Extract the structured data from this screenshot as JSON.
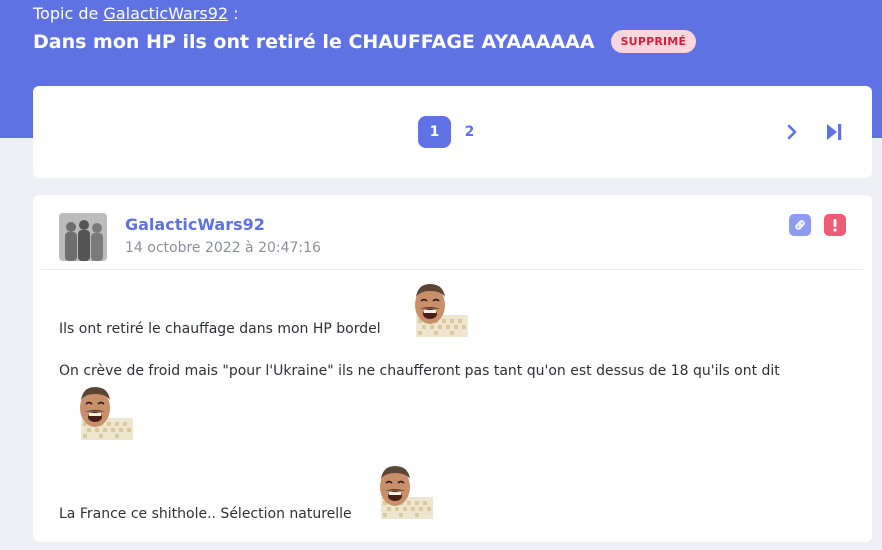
{
  "header": {
    "topic_prefix": "Topic de",
    "topic_author": "GalacticWars92",
    "topic_suffix": " :",
    "title": "Dans mon HP ils ont retiré le CHAUFFAGE AYAAAAAA",
    "status_badge": "SUPPRIMÉ"
  },
  "pagination": {
    "pages": [
      "1",
      "2"
    ],
    "current": "1",
    "next_icon": "chevron-right-icon",
    "last_icon": "skip-to-end-icon"
  },
  "post": {
    "author": "GalacticWars92",
    "date": "14 octobre 2022 à 20:47:16",
    "actions": [
      "link-icon",
      "report-icon"
    ],
    "paragraphs": [
      "Ils ont retiré le chauffage dans mon HP bordel",
      "On crève de froid mais \"pour l'Ukraine\" ils ne chaufferont pas tant qu'on est dessus de 18 qu'ils ont dit",
      "La France ce shithole.. Sélection naturelle"
    ],
    "smiley": "risitas-smiley"
  },
  "colors": {
    "accent": "#5f72e3",
    "danger_badge_bg": "#fbd6dc",
    "danger_badge_text": "#d11f3f",
    "report": "#ef5a74",
    "link": "#8d9cf0"
  }
}
